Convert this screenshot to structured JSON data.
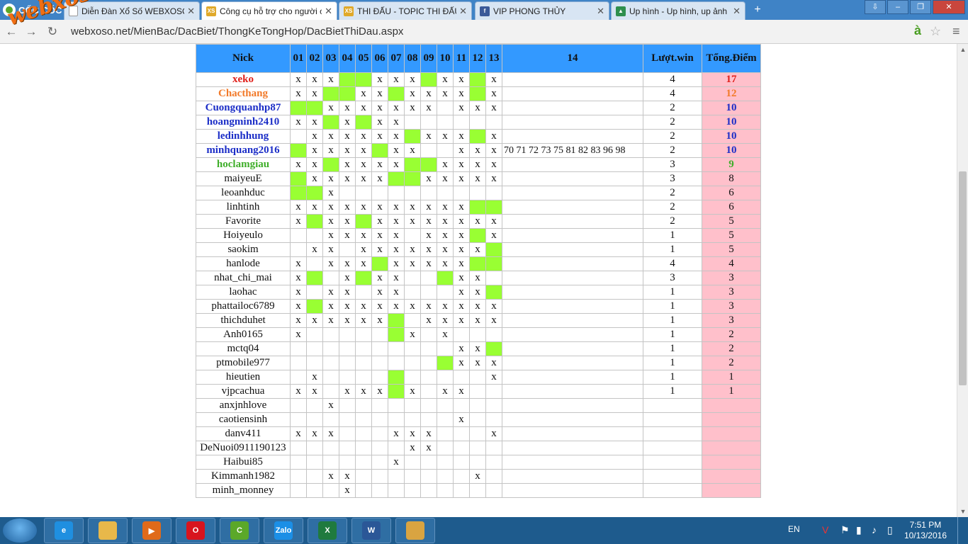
{
  "browser": {
    "brand": "CỐC CỐC",
    "tabs": [
      {
        "label": "Diễn Đàn Xổ Số WEBXOSO.NET",
        "icon": "page-icon",
        "active": false
      },
      {
        "label": "Công cụ hỗ trợ cho người chơi",
        "icon": "xs-icon",
        "active": true
      },
      {
        "label": "THI ĐẤU - TOPIC THI ĐẤU",
        "icon": "xs-icon",
        "active": false
      },
      {
        "label": "VIP PHONG THỦY",
        "icon": "facebook-icon",
        "active": false
      },
      {
        "label": "Up hình - Up hình, up ảnh",
        "icon": "image-icon",
        "active": false
      }
    ],
    "url": "webxoso.net/MienBac/DacBiet/ThongKeTongHop/DacBietThiDau.aspx",
    "watermark": "webxoso.net"
  },
  "table": {
    "headers": {
      "nick": "Nick",
      "cols": [
        "01",
        "02",
        "03",
        "04",
        "05",
        "06",
        "07",
        "08",
        "09",
        "10",
        "11",
        "12",
        "13"
      ],
      "col14": "14",
      "wins": "Lượt.win",
      "points": "Tổng.Điểm"
    },
    "rows": [
      {
        "nick": "xeko",
        "color": "red",
        "cells": "xxxGGxxxGxxGx",
        "c14": "",
        "wins": "4",
        "points": "17"
      },
      {
        "nick": "Chacthang",
        "color": "orange",
        "cells": "xxGGxxGxxxxGx",
        "c14": "",
        "wins": "4",
        "points": "12"
      },
      {
        "nick": "Cuongquanhp87",
        "color": "blue",
        "cells": "GGxxxxxxx.xxx",
        "c14": "",
        "wins": "2",
        "points": "10"
      },
      {
        "nick": "hoangminh2410",
        "color": "blue",
        "cells": "xxGxGxx......",
        "c14": "",
        "wins": "2",
        "points": "10"
      },
      {
        "nick": "ledinhhung",
        "color": "blue",
        "cells": ".xxxxxxGxxxGx",
        "c14": "",
        "wins": "2",
        "points": "10"
      },
      {
        "nick": "minhquang2016",
        "color": "blue",
        "cells": "GxxxxGxx..xxx",
        "c14": "70 71 72 73 75 81 82 83 96 98",
        "wins": "2",
        "points": "10"
      },
      {
        "nick": "hoclamgiau",
        "color": "green",
        "cells": "xxGxxxxGGxxxx",
        "c14": "",
        "wins": "3",
        "points": "9"
      },
      {
        "nick": "maiyeuE",
        "color": "",
        "cells": "GxxxxxGGxxxxx",
        "c14": "",
        "wins": "3",
        "points": "8"
      },
      {
        "nick": "leoanhduc",
        "color": "",
        "cells": "GGx..........",
        "c14": "",
        "wins": "2",
        "points": "6"
      },
      {
        "nick": "linhtinh",
        "color": "",
        "cells": "xxxxxxxxxxxGG",
        "c14": "",
        "wins": "2",
        "points": "6"
      },
      {
        "nick": "Favorite",
        "color": "",
        "cells": "xGxxGxxxxxxxx",
        "c14": "",
        "wins": "2",
        "points": "5"
      },
      {
        "nick": "Hoiyeulo",
        "color": "",
        "cells": "..xxxxx.xxxGx",
        "c14": "",
        "wins": "1",
        "points": "5"
      },
      {
        "nick": "saokim",
        "color": "",
        "cells": ".xx.xxxxxxxxG",
        "c14": "",
        "wins": "1",
        "points": "5"
      },
      {
        "nick": "hanlode",
        "color": "",
        "cells": "x.xxxGxxxxxGG",
        "c14": "",
        "wins": "4",
        "points": "4"
      },
      {
        "nick": "nhat_chi_mai",
        "color": "",
        "cells": "xG.xGxx..Gxx.",
        "c14": "",
        "wins": "3",
        "points": "3"
      },
      {
        "nick": "laohac",
        "color": "",
        "cells": "x.xx.xx...xxG",
        "c14": "",
        "wins": "1",
        "points": "3"
      },
      {
        "nick": "phattailoc6789",
        "color": "",
        "cells": "xGxxxxxxxxxxx",
        "c14": "",
        "wins": "1",
        "points": "3"
      },
      {
        "nick": "thichduhet",
        "color": "",
        "cells": "xxxxxxG.xxxxx",
        "c14": "",
        "wins": "1",
        "points": "3"
      },
      {
        "nick": "Anh0165",
        "color": "",
        "cells": "x.....Gx.x...",
        "c14": "",
        "wins": "1",
        "points": "2"
      },
      {
        "nick": "mctq04",
        "color": "",
        "cells": "..........xxG",
        "c14": "",
        "wins": "1",
        "points": "2"
      },
      {
        "nick": "ptmobile977",
        "color": "",
        "cells": ".........Gxxx",
        "c14": "",
        "wins": "1",
        "points": "2"
      },
      {
        "nick": "hieutien",
        "color": "",
        "cells": ".x....G.....x",
        "c14": "",
        "wins": "1",
        "points": "1"
      },
      {
        "nick": "vjpcachua",
        "color": "",
        "cells": "xx.xxxGx.xx..",
        "c14": "",
        "wins": "1",
        "points": "1"
      },
      {
        "nick": "anxjnhlove",
        "color": "",
        "cells": "..x..........",
        "c14": "",
        "wins": "",
        "points": ""
      },
      {
        "nick": "caotiensinh",
        "color": "",
        "cells": "..........x..",
        "c14": "",
        "wins": "",
        "points": ""
      },
      {
        "nick": "danv411",
        "color": "",
        "cells": "xxx...xxx...x",
        "c14": "",
        "wins": "",
        "points": ""
      },
      {
        "nick": "DeNuoi0911190123",
        "color": "",
        "cells": ".......xx....",
        "c14": "",
        "wins": "",
        "points": ""
      },
      {
        "nick": "Haibui85",
        "color": "",
        "cells": "......x......",
        "c14": "",
        "wins": "",
        "points": ""
      },
      {
        "nick": "Kimmanh1982",
        "color": "",
        "cells": "..xx.......x.",
        "c14": "",
        "wins": "",
        "points": ""
      },
      {
        "nick": "minh_monney",
        "color": "",
        "cells": "...x.........",
        "c14": "",
        "wins": "",
        "points": ""
      }
    ]
  },
  "colors": {
    "header_bg": "#3399ff",
    "hit_green": "#99ff33",
    "points_pink": "#ffc0cb",
    "red": "#e0201b",
    "orange": "#f27a2a",
    "blue": "#1c2ec7",
    "green": "#3fae2a"
  },
  "taskbar": {
    "apps": [
      {
        "name": "internet-explorer-icon",
        "label": "e",
        "color": "#1f8fe0"
      },
      {
        "name": "file-explorer-icon",
        "label": "",
        "color": "#e8b84a"
      },
      {
        "name": "media-player-icon",
        "label": "▶",
        "color": "#e06a1a"
      },
      {
        "name": "opera-icon",
        "label": "O",
        "color": "#d8141e"
      },
      {
        "name": "coccoc-icon",
        "label": "C",
        "color": "#5ba829"
      },
      {
        "name": "zalo-icon",
        "label": "Zalo",
        "color": "#1b8fe6"
      },
      {
        "name": "excel-icon",
        "label": "X",
        "color": "#1f7a3e"
      },
      {
        "name": "word-icon",
        "label": "W",
        "color": "#2b5797"
      },
      {
        "name": "paint-icon",
        "label": "",
        "color": "#d9a441"
      }
    ],
    "language": "EN",
    "time": "7:51 PM",
    "date": "10/13/2016"
  }
}
